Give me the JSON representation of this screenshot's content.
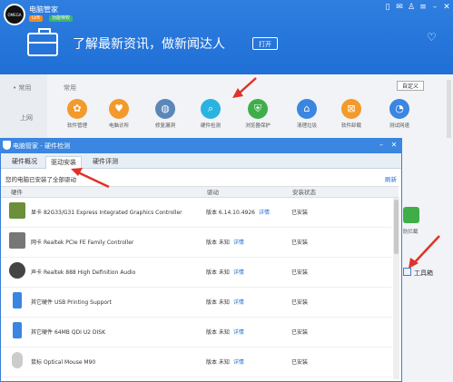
{
  "titlebar": {
    "username": "电脑管家",
    "badge1": "LV8",
    "badge2": "功能特权",
    "ctl_icons": [
      "phone-icon",
      "mail-icon",
      "shirt-icon",
      "menu-icon",
      "minimize-icon",
      "close-icon"
    ]
  },
  "header": {
    "avatar_text": "OMEGA",
    "slogan": "了解最新资讯，做新闻达人",
    "open_button": "打开"
  },
  "sidebar": {
    "item1": "常用",
    "item2": "上网"
  },
  "tools_panel": {
    "section_title": "常用",
    "custom_button": "自定义",
    "tools": [
      {
        "label": "软件管理",
        "icon": "puzzle-icon",
        "color": "#f39a2b"
      },
      {
        "label": "电脑诊所",
        "icon": "stethoscope-icon",
        "color": "#f39a2b"
      },
      {
        "label": "修复漏洞",
        "icon": "globe-icon",
        "color": "#5b86b8"
      },
      {
        "label": "硬件检测",
        "icon": "search-icon",
        "color": "#2bb3e0"
      },
      {
        "label": "浏览器保护",
        "icon": "shield-icon",
        "color": "#3fae49"
      },
      {
        "label": "清理垃圾",
        "icon": "broom-icon",
        "color": "#3a86e0"
      },
      {
        "label": "软件卸载",
        "icon": "trash-icon",
        "color": "#f39a2b"
      },
      {
        "label": "测试网速",
        "icon": "speedometer-icon",
        "color": "#3a86e0"
      }
    ]
  },
  "dialog": {
    "title": "电脑管家 - 硬件检测",
    "tabs": [
      "硬件概况",
      "驱动安装",
      "硬件评测"
    ],
    "info": "您的电脑已安装了全部驱动",
    "refresh": "刷新",
    "columns": [
      "硬件",
      "驱动",
      "安装状态"
    ],
    "rows": [
      {
        "type": "显卡",
        "name": "82G33/G31 Express Integrated Graphics Controller",
        "version": "版本 6.14.10.4926",
        "detail": "详情",
        "status": "已安装",
        "icon": "graphics-card-icon"
      },
      {
        "type": "网卡",
        "name": "Realtek PCIe FE Family Controller",
        "version": "版本 未知",
        "detail": "详情",
        "status": "已安装",
        "icon": "network-card-icon"
      },
      {
        "type": "声卡",
        "name": "Realtek 888 High Definition Audio",
        "version": "版本 未知",
        "detail": "详情",
        "status": "已安装",
        "icon": "speaker-icon"
      },
      {
        "type": "其它硬件",
        "name": "USB Printing Support",
        "version": "版本 未知",
        "detail": "详情",
        "status": "已安装",
        "icon": "usb-icon"
      },
      {
        "type": "其它硬件",
        "name": "64MB QDI U2 DISK",
        "version": "版本 未知",
        "detail": "详情",
        "status": "已安装",
        "icon": "usb-drive-icon"
      },
      {
        "type": "鼠标",
        "name": "Optical Mouse M90",
        "version": "版本 未知",
        "detail": "详情",
        "status": "已安装",
        "icon": "mouse-icon"
      }
    ]
  },
  "right_tools": {
    "item1": "防拦截",
    "toolbox": "工具箱"
  },
  "colors": {
    "accent": "#2f7ee0",
    "arrow": "#e0322a",
    "link": "#2a6fd0"
  }
}
